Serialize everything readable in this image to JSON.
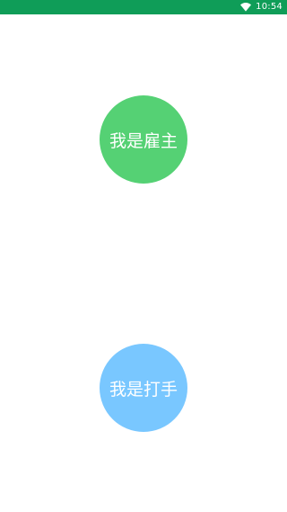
{
  "status_bar": {
    "time": "10:54",
    "background": "#0f9d58",
    "icons": [
      "wifi-icon"
    ]
  },
  "roles": {
    "employer": {
      "label": "我是雇主",
      "color": "#55d174"
    },
    "fighter": {
      "label": "我是打手",
      "color": "#79c7ff"
    }
  }
}
